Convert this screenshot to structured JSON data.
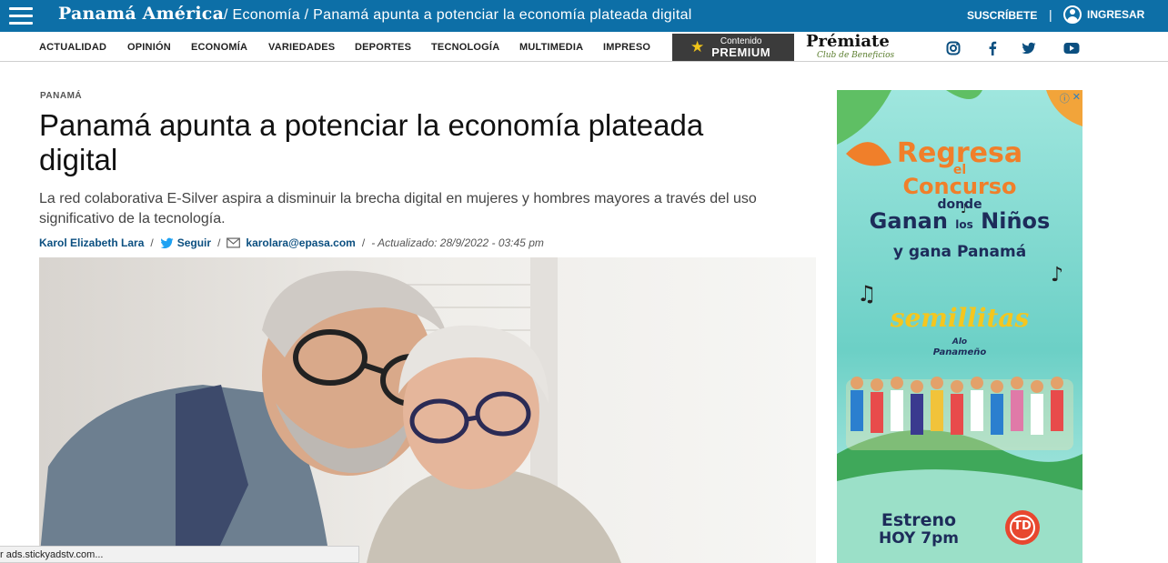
{
  "header": {
    "logo": "Panamá América",
    "breadcrumb": "/ Economía / Panamá apunta a potenciar la economía plateada digital",
    "subscribe": "SUSCRÍBETE",
    "separator": "|",
    "login": "INGRESAR"
  },
  "nav": {
    "items": [
      "ACTUALIDAD",
      "OPINIÓN",
      "ECONOMÍA",
      "VARIEDADES",
      "DEPORTES",
      "TECNOLOGÍA",
      "MULTIMEDIA",
      "IMPRESO"
    ],
    "premium_top": "Contenido",
    "premium_bottom": "PREMIUM",
    "premiate": "Prémiate",
    "premiate_sub": "Club de Beneficios",
    "social_icons": [
      "instagram-icon",
      "facebook-icon",
      "twitter-icon",
      "youtube-icon"
    ]
  },
  "article": {
    "section": "PANAMÁ",
    "title": "Panamá apunta a potenciar la economía plateada digital",
    "dek": "La red colaborativa E-Silver aspira a disminuir la brecha digital en mujeres y hombres mayores a través del uso significativo de la tecnología.",
    "author": "Karol Elizabeth Lara",
    "slash": "/",
    "follow": "Seguir",
    "email": "karolara@epasa.com",
    "updated": "- Actualizado: 28/9/2022 - 03:45 pm"
  },
  "ad": {
    "line1": "Regresa",
    "line2": "el",
    "line3": "Concurso",
    "line4": "donde",
    "line5a": "Ganan",
    "line5b": "los",
    "line5c": "Niños",
    "line6": "y gana Panamá",
    "brand": "semillitas",
    "sub_brand_1": "Alo",
    "sub_brand_2": "Panameño",
    "release1": "Estreno",
    "release2": "HOY 7pm",
    "channel": "TD",
    "info": "ⓘ",
    "close": "✕"
  },
  "status_bar": "r ads.stickyadstv.com..."
}
